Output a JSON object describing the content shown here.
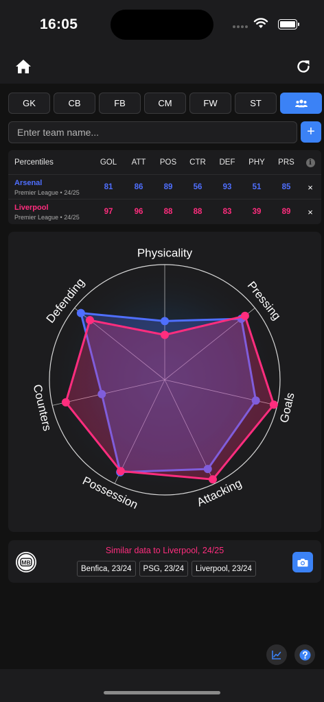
{
  "status": {
    "time": "16:05"
  },
  "positions": [
    {
      "label": "GK",
      "active": false
    },
    {
      "label": "CB",
      "active": false
    },
    {
      "label": "FB",
      "active": false
    },
    {
      "label": "CM",
      "active": false
    },
    {
      "label": "FW",
      "active": false
    },
    {
      "label": "ST",
      "active": false
    },
    {
      "label": "",
      "icon": "team-icon",
      "active": true
    }
  ],
  "team_input": {
    "placeholder": "Enter team name...",
    "value": ""
  },
  "add_button": {
    "label": "+"
  },
  "table": {
    "title": "Percentiles",
    "columns": [
      "GOL",
      "ATT",
      "POS",
      "CTR",
      "DEF",
      "PHY",
      "PRS"
    ],
    "rows": [
      {
        "team": "Arsenal",
        "league": "Premier League • 24/25",
        "color": "#4f6fff",
        "values": [
          81,
          86,
          89,
          56,
          93,
          51,
          85
        ],
        "remove": "×"
      },
      {
        "team": "Liverpool",
        "league": "Premier League • 24/25",
        "color": "#ff2d7e",
        "values": [
          97,
          96,
          88,
          88,
          83,
          39,
          89
        ],
        "remove": "×"
      }
    ]
  },
  "radar": {
    "axes": [
      "Physicality",
      "Pressing",
      "Goals",
      "Attacking",
      "Possession",
      "Counters",
      "Defending"
    ],
    "max": 100
  },
  "chart_data": {
    "type": "radar",
    "axes": [
      "Physicality",
      "Pressing",
      "Goals",
      "Attacking",
      "Possession",
      "Counters",
      "Defending"
    ],
    "range": [
      0,
      100
    ],
    "series": [
      {
        "name": "Arsenal",
        "color": "#4f6fff",
        "values": [
          51,
          85,
          81,
          86,
          89,
          56,
          93
        ]
      },
      {
        "name": "Liverpool",
        "color": "#ff2d7e",
        "values": [
          39,
          89,
          97,
          96,
          88,
          88,
          83
        ]
      }
    ]
  },
  "similar": {
    "title": "Similar data to Liverpool, 24/25",
    "chips": [
      "Benfica, 23/24",
      "PSG, 23/24",
      "Liverpool, 23/24"
    ],
    "logo_text": "MB"
  },
  "colors": {
    "accent": "#3b82f6",
    "team_a": "#4f6fff",
    "team_b": "#ff2d7e"
  }
}
